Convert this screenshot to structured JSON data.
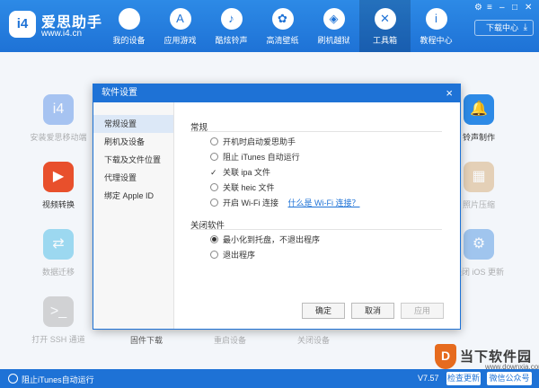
{
  "app": {
    "logo_text": "i4",
    "name": "爱思助手",
    "url": "www.i4.cn"
  },
  "nav": {
    "items": [
      {
        "label": "我的设备",
        "icon": "apple-icon",
        "glyph": ""
      },
      {
        "label": "应用游戏",
        "icon": "app-store-icon",
        "glyph": "A"
      },
      {
        "label": "酷炫铃声",
        "icon": "bell-icon",
        "glyph": "♪"
      },
      {
        "label": "高清壁纸",
        "icon": "flower-icon",
        "glyph": "✿"
      },
      {
        "label": "刷机越狱",
        "icon": "dropbox-icon",
        "glyph": "◈"
      },
      {
        "label": "工具箱",
        "icon": "tools-icon",
        "glyph": "✕"
      },
      {
        "label": "教程中心",
        "icon": "info-icon",
        "glyph": "i"
      }
    ],
    "active_index": 5,
    "download_center": "下载中心",
    "download_arrow": "⤓",
    "window_controls": [
      "⚙",
      "≡",
      "–",
      "□",
      "✕"
    ]
  },
  "tools": {
    "left": [
      {
        "label": "安装爱思移动端",
        "glyph": "i4",
        "color": "#4a86e8"
      },
      {
        "label": "视频转换",
        "glyph": "▶",
        "color": "#e8502c"
      },
      {
        "label": "数据迁移",
        "glyph": "⇄",
        "color": "#33b4e6"
      },
      {
        "label": "打开 SSH 通道",
        "glyph": ">_",
        "color": "#a8a8a8"
      }
    ],
    "right": [
      {
        "label": "铃声制作",
        "glyph": "🔔",
        "color": "#2d8ae6"
      },
      {
        "label": "照片压缩",
        "glyph": "▦",
        "color": "#d4a368"
      },
      {
        "label": "关闭 iOS 更新",
        "glyph": "⚙",
        "color": "#3d8ae0"
      }
    ],
    "bottom": [
      "固件下载",
      "重启设备",
      "关闭设备"
    ]
  },
  "modal": {
    "title": "软件设置",
    "close": "×",
    "sidebar": [
      "常规设置",
      "刷机及设备",
      "下载及文件位置",
      "代理设置",
      "绑定 Apple ID"
    ],
    "active_tab": 0,
    "section_general": "常规",
    "options_general": [
      {
        "label": "开机时启动爱思助手",
        "checked": false
      },
      {
        "label": "阻止 iTunes 自动运行",
        "checked": false
      },
      {
        "label": "关联 ipa 文件",
        "checked": true
      },
      {
        "label": "关联 heic 文件",
        "checked": false
      },
      {
        "label": "开启 Wi-Fi 连接",
        "checked": false
      }
    ],
    "wifi_link": "什么是 Wi-Fi 连接？",
    "section_close": "关闭软件",
    "close_options": [
      {
        "label": "最小化到托盘，不退出程序",
        "selected": true
      },
      {
        "label": "退出程序",
        "selected": false
      }
    ],
    "buttons": {
      "ok": "确定",
      "cancel": "取消",
      "apply": "应用"
    }
  },
  "statusbar": {
    "text": "阻止iTunes自动运行",
    "version": "V7.57",
    "check_update": "检查更新",
    "wechat": "微信公众号"
  },
  "watermark": {
    "name": "当下软件园",
    "url": "www.downxia.com",
    "glyph": "D"
  }
}
